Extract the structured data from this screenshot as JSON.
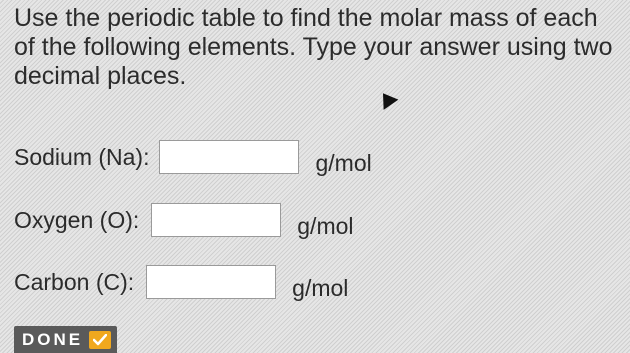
{
  "prompt": {
    "text": "Use the periodic table to find the molar mass of each of the following elements. Type your answer using two decimal places."
  },
  "rows": [
    {
      "label": "Sodium (Na):",
      "value": "",
      "unit": "g/mol"
    },
    {
      "label": "Oxygen (O):",
      "value": "",
      "unit": "g/mol"
    },
    {
      "label": "Carbon (C):",
      "value": "",
      "unit": "g/mol"
    }
  ],
  "done_button": {
    "label": "DONE",
    "icon": "check-icon"
  },
  "colors": {
    "check_accent": "#f0a81e",
    "button_bg": "#5a5a5a"
  }
}
